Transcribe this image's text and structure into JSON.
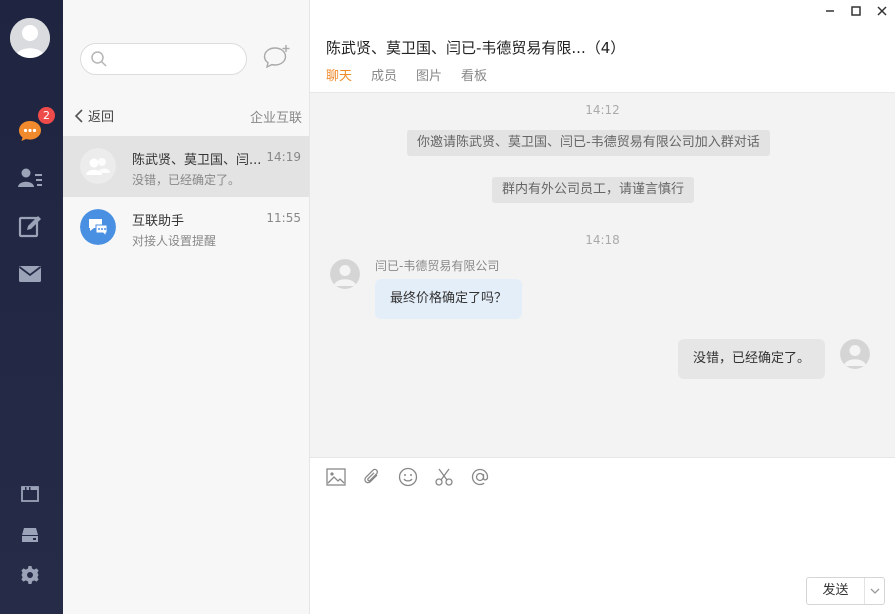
{
  "rail": {
    "unread_badge": "2",
    "accent": "#f08a2c",
    "icons": [
      "chat-icon",
      "contacts-icon",
      "edit-icon",
      "mail-icon",
      "window-icon",
      "inbox-icon",
      "gear-icon"
    ]
  },
  "list": {
    "search": {
      "placeholder": ""
    },
    "back_label": "返回",
    "enterprise_label": "企业互联",
    "conversations": [
      {
        "name": "陈武贤、莫卫国、闫...",
        "time": "14:19",
        "preview": "没错，已经确定了。"
      },
      {
        "name": "互联助手",
        "time": "11:55",
        "preview": "对接人设置提醒"
      }
    ]
  },
  "chat": {
    "title": "陈武贤、莫卫国、闫已-韦德贸易有限...（4）",
    "tabs": [
      "聊天",
      "成员",
      "图片",
      "看板"
    ],
    "messages": {
      "ts1": "14:12",
      "sys1": "你邀请陈武贤、莫卫国、闫已-韦德贸易有限公司加入群对话",
      "sys2": "群内有外公司员工，请谨言慎行",
      "ts2": "14:18",
      "sender": "闫已-韦德贸易有限公司",
      "incoming": "最终价格确定了吗？",
      "outgoing": "没错，已经确定了。"
    },
    "send_label": "发送"
  }
}
